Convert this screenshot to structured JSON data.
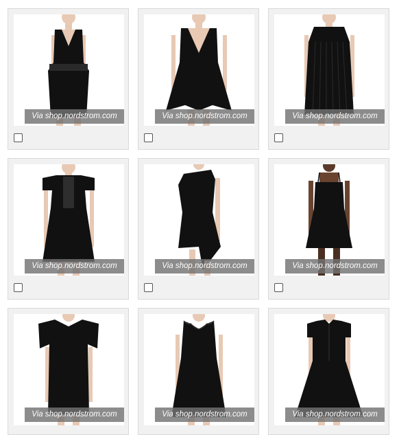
{
  "products": [
    {
      "caption": "Via shop.nordstrom.com",
      "item": "peplum lace-panel sheath dress",
      "selected": false
    },
    {
      "caption": "Via shop.nordstrom.com",
      "item": "v-neck flared midi dress",
      "selected": false
    },
    {
      "caption": "Via shop.nordstrom.com",
      "item": "pleated shift dress",
      "selected": false
    },
    {
      "caption": "Via shop.nordstrom.com",
      "item": "lace-inset fit and flare dress",
      "selected": false
    },
    {
      "caption": "Via shop.nordstrom.com",
      "item": "asymmetric hem one-shoulder dress",
      "selected": false
    },
    {
      "caption": "Via shop.nordstrom.com",
      "item": "strappy skater dress",
      "selected": false
    },
    {
      "caption": "Via shop.nordstrom.com",
      "item": "cold-shoulder ruffle dress",
      "selected": false
    },
    {
      "caption": "Via shop.nordstrom.com",
      "item": "scalloped lace dress",
      "selected": false
    },
    {
      "caption": "Via shop.nordstrom.com",
      "item": "collared shirt dress",
      "selected": false
    }
  ],
  "colors": {
    "card_bg": "#f1f1f1",
    "card_border": "#d9d9d9",
    "caption_bg": "#737373",
    "dress": "#111111",
    "skin": "#e8c9b4"
  }
}
